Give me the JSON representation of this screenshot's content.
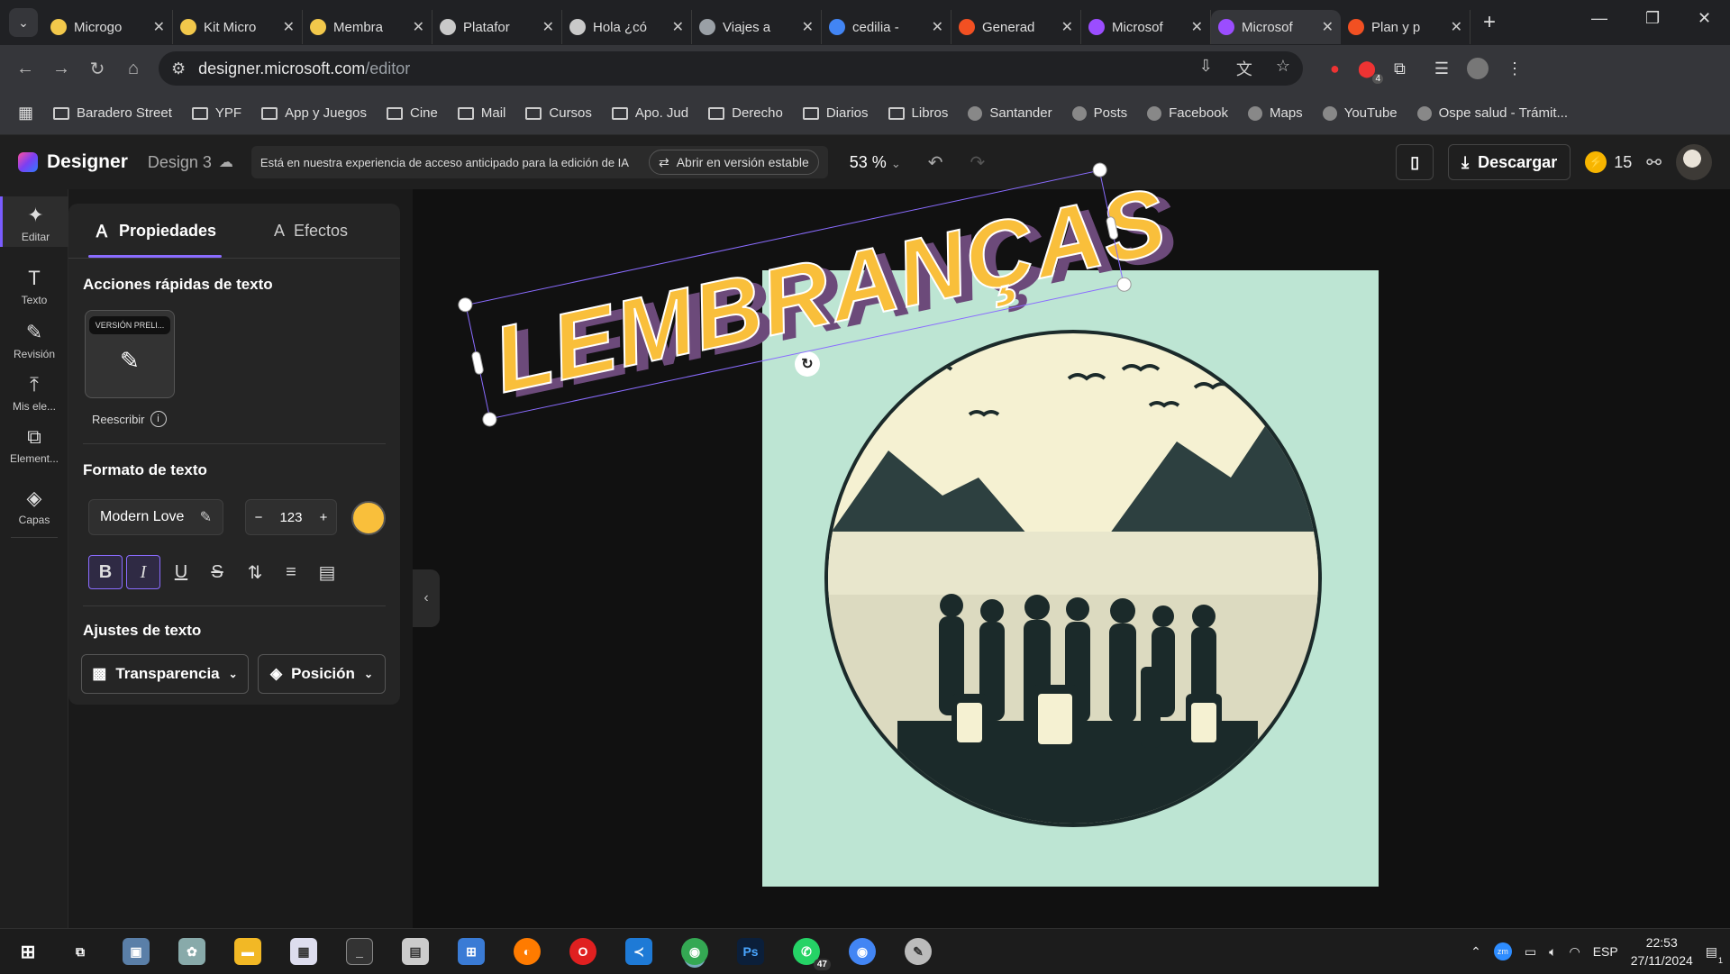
{
  "browser": {
    "tabs": [
      {
        "title": "Microgo",
        "favicon_color": "#f2c84b"
      },
      {
        "title": "Kit Micro",
        "favicon_color": "#f2c84b"
      },
      {
        "title": "Membra",
        "favicon_color": "#f2c84b"
      },
      {
        "title": "Platafor",
        "favicon_color": "#c9c9c9"
      },
      {
        "title": "Hola ¿có",
        "favicon_color": "#c9c9c9"
      },
      {
        "title": "Viajes a",
        "favicon_color": "#9aa0a6"
      },
      {
        "title": "cedilia -",
        "favicon_color": "#4285f4"
      },
      {
        "title": "Generad",
        "favicon_color": "#f25022"
      },
      {
        "title": "Microsof",
        "favicon_color": "#9b4dff"
      },
      {
        "title": "Microsof",
        "favicon_color": "#9b4dff",
        "active": true
      },
      {
        "title": "Plan y p",
        "favicon_color": "#f25022"
      }
    ],
    "url_host": "designer.microsoft.com",
    "url_path": "/editor",
    "ext_badge": "4",
    "bookmarks": [
      {
        "label": "Baradero Street",
        "icon": "folder-icon"
      },
      {
        "label": "YPF",
        "icon": "folder-icon"
      },
      {
        "label": "App y Juegos",
        "icon": "folder-icon"
      },
      {
        "label": "Cine",
        "icon": "folder-icon"
      },
      {
        "label": "Mail",
        "icon": "folder-icon"
      },
      {
        "label": "Cursos",
        "icon": "folder-icon"
      },
      {
        "label": "Apo. Jud",
        "icon": "folder-icon"
      },
      {
        "label": "Derecho",
        "icon": "folder-icon"
      },
      {
        "label": "Diarios",
        "icon": "folder-icon"
      },
      {
        "label": "Libros",
        "icon": "folder-icon"
      },
      {
        "label": "Santander",
        "icon": "santander-icon"
      },
      {
        "label": "Posts",
        "icon": "posts-icon"
      },
      {
        "label": "Facebook",
        "icon": "facebook-icon"
      },
      {
        "label": "Maps",
        "icon": "maps-icon"
      },
      {
        "label": "YouTube",
        "icon": "youtube-icon"
      },
      {
        "label": "Ospe salud - Trámit...",
        "icon": "ospe-icon"
      }
    ]
  },
  "app": {
    "brand": "Designer",
    "doc_name": "Design 3",
    "banner_text": "Está en nuestra experiencia de acceso anticipado para la edición de IA",
    "stable_button": "Abrir en versión estable",
    "zoom": "53 %",
    "download": "Descargar",
    "coins": "15"
  },
  "rail": [
    {
      "label": "Editar",
      "icon": "sparkle-icon"
    },
    {
      "label": "Texto",
      "icon": "text-icon"
    },
    {
      "label": "Revisión",
      "icon": "pen-icon"
    },
    {
      "label": "Mis ele...",
      "icon": "upload-icon"
    },
    {
      "label": "Element...",
      "icon": "elements-icon"
    },
    {
      "label": "Capas",
      "icon": "layers-icon"
    }
  ],
  "panel": {
    "tab_props": "Propiedades",
    "tab_effects": "Efectos",
    "quick_actions_title": "Acciones rápidas de texto",
    "preview_badge": "VERSIÓN PRELI...",
    "rewrite_label": "Reescribir",
    "format_title": "Formato de texto",
    "font_name": "Modern Love",
    "font_size": "123",
    "text_color": "#f9bf3b",
    "adjust_title": "Ajustes de texto",
    "transparency": "Transparencia",
    "position": "Posición"
  },
  "canvas": {
    "title_text": "LEMBRANÇAS",
    "title_color": "#f9bf3b",
    "shadow_color": "#6c4a7a",
    "artboard_color": "#bde5d3"
  },
  "taskbar": {
    "whatsapp_badge": "47",
    "lang": "ESP",
    "time": "22:53",
    "date": "27/11/2024",
    "notif_count": "1"
  }
}
